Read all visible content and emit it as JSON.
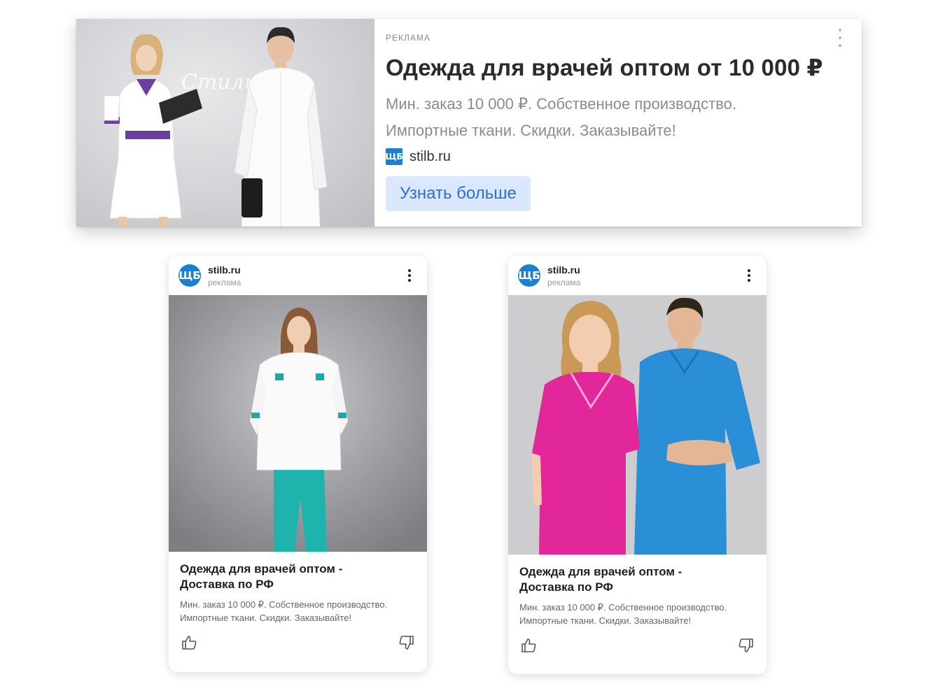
{
  "banner": {
    "ad_label": "РЕКЛАМА",
    "title": "Одежда для врачей оптом от 10 000 ₽",
    "desc_line1": "Мин. заказ 10 000 ₽. Собственное производство.",
    "desc_line2": "Импортные ткани. Скидки. Заказывайте!",
    "domain": "stilb.ru",
    "cta": "Узнать больше",
    "logo_text": "ЩБ"
  },
  "cards": [
    {
      "domain": "stilb.ru",
      "ad_label": "реклама",
      "logo_text": "ЩБ",
      "title_line1": "Одежда для врачей оптом -",
      "title_line2": "Доставка по РФ",
      "desc_line1": "Мин. заказ 10 000 ₽. Собственное производство.",
      "desc_line2": "Импортные ткани. Скидки. Заказывайте!"
    },
    {
      "domain": "stilb.ru",
      "ad_label": "реклама",
      "logo_text": "ЩБ",
      "title_line1": "Одежда для врачей оптом -",
      "title_line2": "Доставка по РФ",
      "desc_line1": "Мин. заказ 10 000 ₽. Собственное производство.",
      "desc_line2": "Импортные ткани. Скидки. Заказывайте!"
    }
  ],
  "icons": {
    "menu": "kebab-menu-icon",
    "like": "thumbs-up-icon",
    "dislike": "thumbs-down-icon",
    "logo": "stilb-logo-icon"
  },
  "colors": {
    "brand_blue": "#1a7fd1",
    "cta_background": "#dbe7fd",
    "cta_text": "#2a6fd6"
  }
}
